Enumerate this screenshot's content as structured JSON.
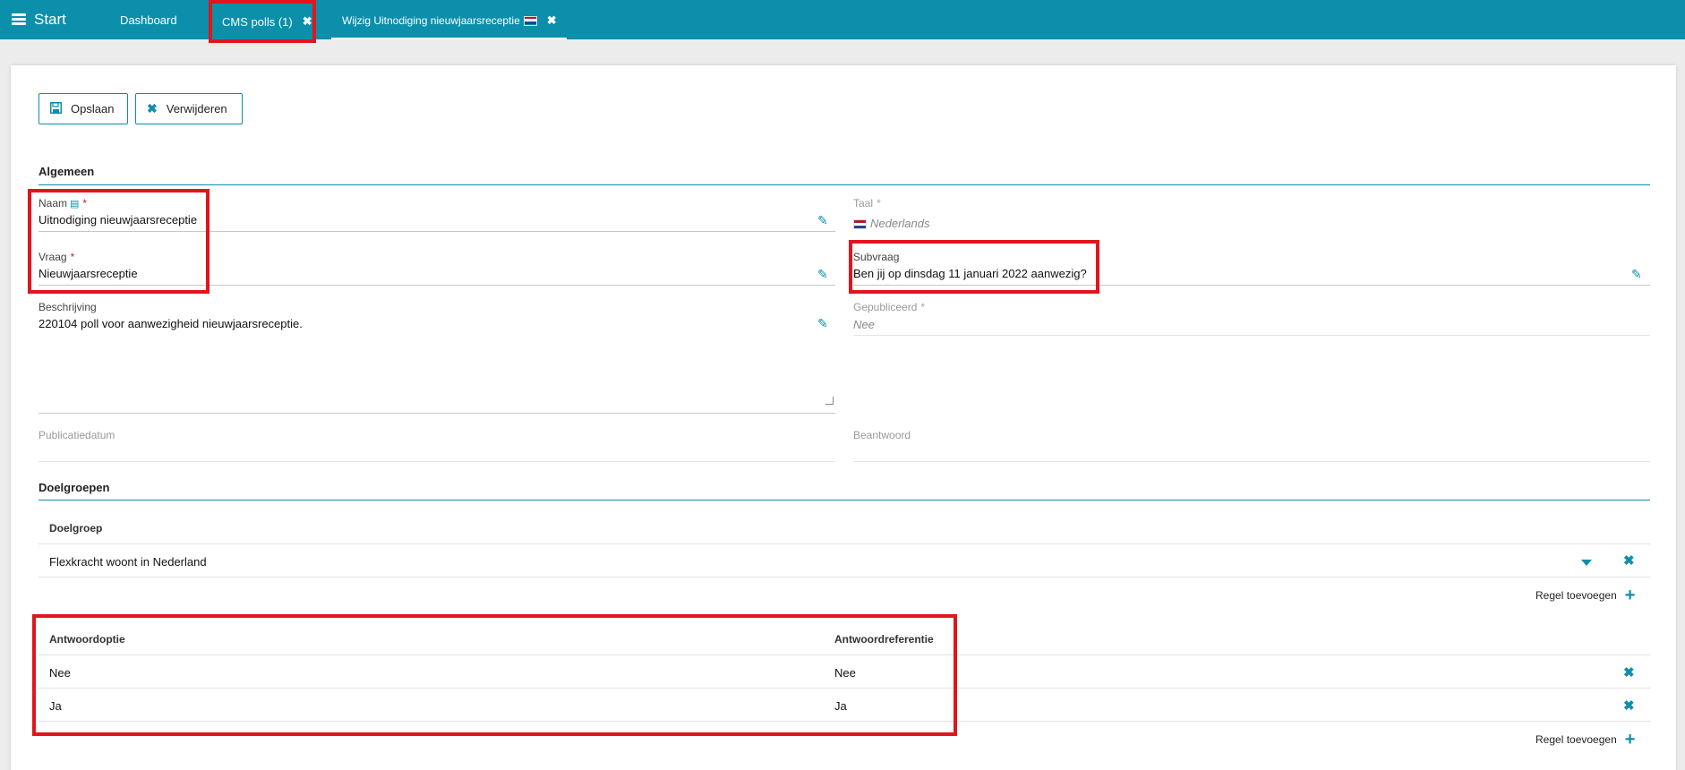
{
  "topbar": {
    "start_label": "Start",
    "tabs": [
      {
        "label": "Dashboard"
      },
      {
        "label": "CMS polls (1)",
        "close": "✖"
      },
      {
        "label": "Wijzig Uitnodiging nieuwjaarsreceptie",
        "close": "✖"
      }
    ]
  },
  "toolbar": {
    "save_label": "Opslaan",
    "delete_label": "Verwijderen"
  },
  "general": {
    "title": "Algemeen",
    "naam_label": "Naam",
    "naam_value": "Uitnodiging nieuwjaarsreceptie",
    "taal_label": "Taal",
    "taal_value": "Nederlands",
    "vraag_label": "Vraag",
    "vraag_value": "Nieuwjaarsreceptie",
    "subvraag_label": "Subvraag",
    "subvraag_value": "Ben jij op dinsdag 11 januari 2022 aanwezig?",
    "beschrijving_label": "Beschrijving",
    "beschrijving_value": "220104 poll voor aanwezigheid nieuwjaarsreceptie.",
    "gepubliceerd_label": "Gepubliceerd",
    "gepubliceerd_value": "Nee",
    "publicatiedatum_label": "Publicatiedatum",
    "beantwoord_label": "Beantwoord",
    "required_mark": "*"
  },
  "targets": {
    "title": "Doelgroepen",
    "column": "Doelgroep",
    "rows": [
      {
        "value": "Flexkracht woont in Nederland"
      }
    ],
    "add_label": "Regel toevoegen"
  },
  "answers": {
    "columns": [
      "Antwoordoptie",
      "Antwoordreferentie"
    ],
    "rows": [
      {
        "option": "Nee",
        "reference": "Nee"
      },
      {
        "option": "Ja",
        "reference": "Ja"
      }
    ],
    "add_label": "Regel toevoegen"
  },
  "colors": {
    "accent": "#0b8fab",
    "highlight": "#e2141c",
    "flag": [
      "#ae1c28",
      "#ffffff",
      "#21468b"
    ]
  }
}
